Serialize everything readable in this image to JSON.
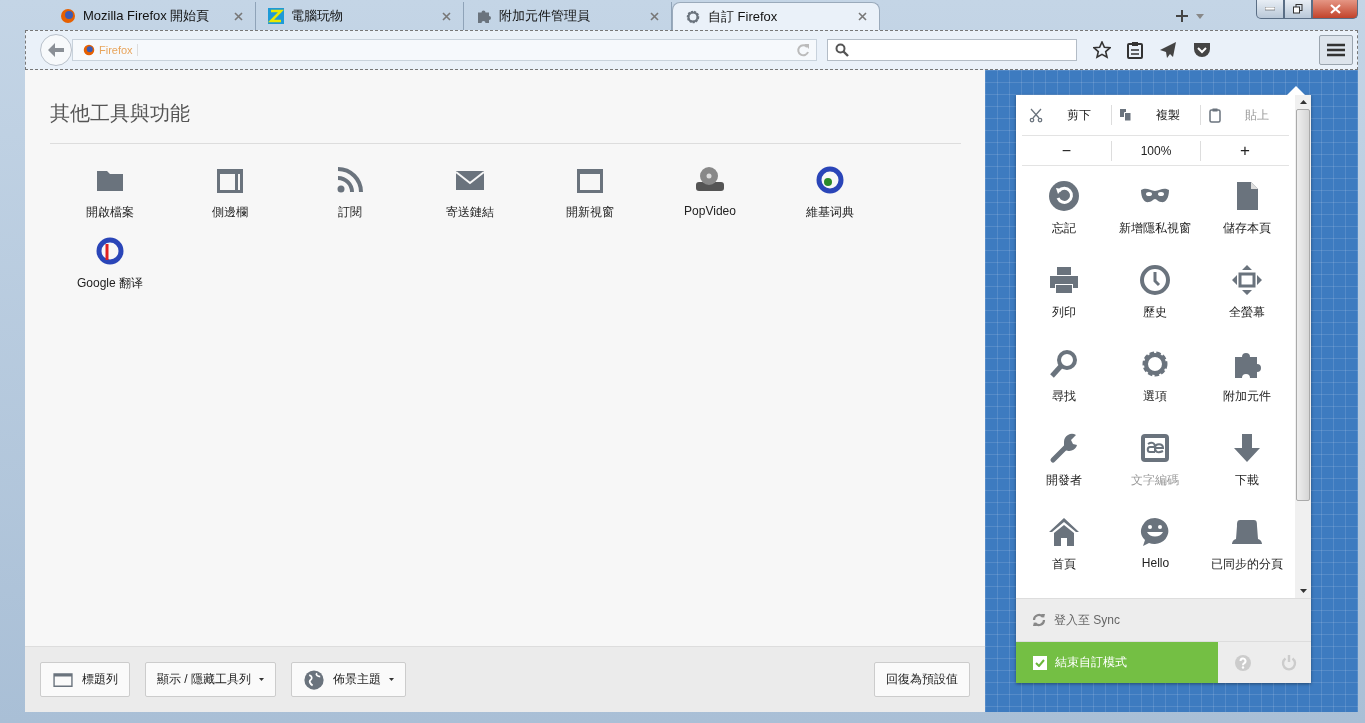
{
  "tabs": [
    {
      "title": "Mozilla Firefox 開始頁",
      "kind": "firefox",
      "selected": false
    },
    {
      "title": "電腦玩物",
      "kind": "site",
      "selected": false
    },
    {
      "title": "附加元件管理員",
      "kind": "puzzle",
      "selected": false
    },
    {
      "title": "自訂 Firefox",
      "kind": "gear",
      "selected": true
    }
  ],
  "url_bar": {
    "identity": "Firefox"
  },
  "palette": {
    "title": "其他工具與功能",
    "items": [
      {
        "label": "開啟檔案",
        "kind": "folder"
      },
      {
        "label": "側邊欄",
        "kind": "sidebar"
      },
      {
        "label": "訂閱",
        "kind": "rss"
      },
      {
        "label": "寄送鏈結",
        "kind": "mail"
      },
      {
        "label": "開新視窗",
        "kind": "window"
      },
      {
        "label": "PopVideo",
        "kind": "film"
      },
      {
        "label": "維基词典",
        "kind": "dg"
      },
      {
        "label": "Google 翻译",
        "kind": "gt"
      }
    ]
  },
  "bottom_bar": {
    "buttons": [
      {
        "label": "標題列",
        "kind": "titlebar",
        "dropdown": false
      },
      {
        "label": "顯示 / 隱藏工具列",
        "kind": "text",
        "dropdown": true
      },
      {
        "label": "佈景主題",
        "kind": "globe",
        "dropdown": true
      }
    ],
    "restore": "回復為預設值"
  },
  "menu": {
    "edit": [
      {
        "label": "剪下",
        "kind": "cut",
        "disabled": false
      },
      {
        "label": "複製",
        "kind": "copy",
        "disabled": false
      },
      {
        "label": "貼上",
        "kind": "paste",
        "disabled": true
      }
    ],
    "zoom": {
      "out": "−",
      "level": "100%",
      "in": "+"
    },
    "items": [
      {
        "label": "忘記",
        "kind": "forget",
        "disabled": false
      },
      {
        "label": "新增隱私視窗",
        "kind": "mask",
        "disabled": false
      },
      {
        "label": "儲存本頁",
        "kind": "page",
        "disabled": false
      },
      {
        "label": "列印",
        "kind": "printer",
        "disabled": false
      },
      {
        "label": "歷史",
        "kind": "clock",
        "disabled": false
      },
      {
        "label": "全螢幕",
        "kind": "fullscreen",
        "disabled": false
      },
      {
        "label": "尋找",
        "kind": "search",
        "disabled": false
      },
      {
        "label": "選項",
        "kind": "gear",
        "disabled": false
      },
      {
        "label": "附加元件",
        "kind": "puzzle",
        "disabled": false
      },
      {
        "label": "開發者",
        "kind": "wrench",
        "disabled": false
      },
      {
        "label": "文字編碼",
        "kind": "ae",
        "disabled": true
      },
      {
        "label": "下載",
        "kind": "download",
        "disabled": false
      },
      {
        "label": "首頁",
        "kind": "home",
        "disabled": false
      },
      {
        "label": "Hello",
        "kind": "smile",
        "disabled": false
      },
      {
        "label": "已同步的分頁",
        "kind": "tab",
        "disabled": false
      }
    ],
    "sync": "登入至 Sync",
    "exit_customize": {
      "label": "結束自訂模式",
      "checked": true
    }
  }
}
